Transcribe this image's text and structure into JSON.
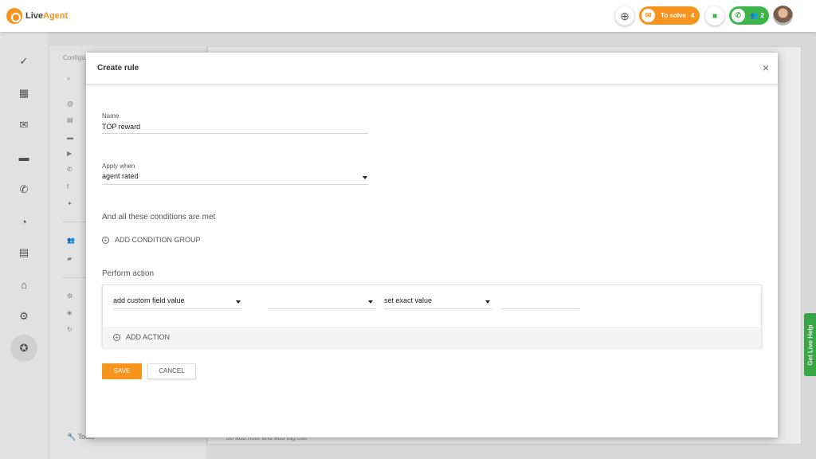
{
  "app": {
    "logo_main": "Live",
    "logo_accent": "Agent"
  },
  "topbar": {
    "add_icon": "plus-circle-icon",
    "to_solve_label": "To solve",
    "to_solve_count": "4",
    "chat_icon": "chat-icon",
    "calls_count": "2"
  },
  "leftnav": {
    "items": [
      "dashboard-check-icon",
      "grid-icon",
      "mail-icon",
      "chat-icon",
      "phone-icon",
      "reports-icon",
      "contacts-icon",
      "bank-icon",
      "gear-icon",
      "star-icon"
    ],
    "active": "gear-icon"
  },
  "background": {
    "panel_title": "Configu",
    "tools_label": "Tools",
    "footer_text": "do add note and add tag call"
  },
  "help_tab": {
    "label": "Get Live Help"
  },
  "modal": {
    "title": "Create rule",
    "name_label": "Name",
    "name_value": "TOP reward",
    "apply_label": "Apply when",
    "apply_value": "agent rated",
    "conditions_text": "And all these conditions are met",
    "add_condition_label": "ADD CONDITION GROUP",
    "perform_label": "Perform action",
    "action": {
      "select1_value": "add custom field value",
      "select2_value": "",
      "select3_value": "set exact value",
      "input_value": ""
    },
    "add_action_label": "ADD ACTION",
    "save_label": "SAVE",
    "cancel_label": "CANCEL"
  },
  "colors": {
    "accent": "#f7941e",
    "green": "#3db54a"
  }
}
